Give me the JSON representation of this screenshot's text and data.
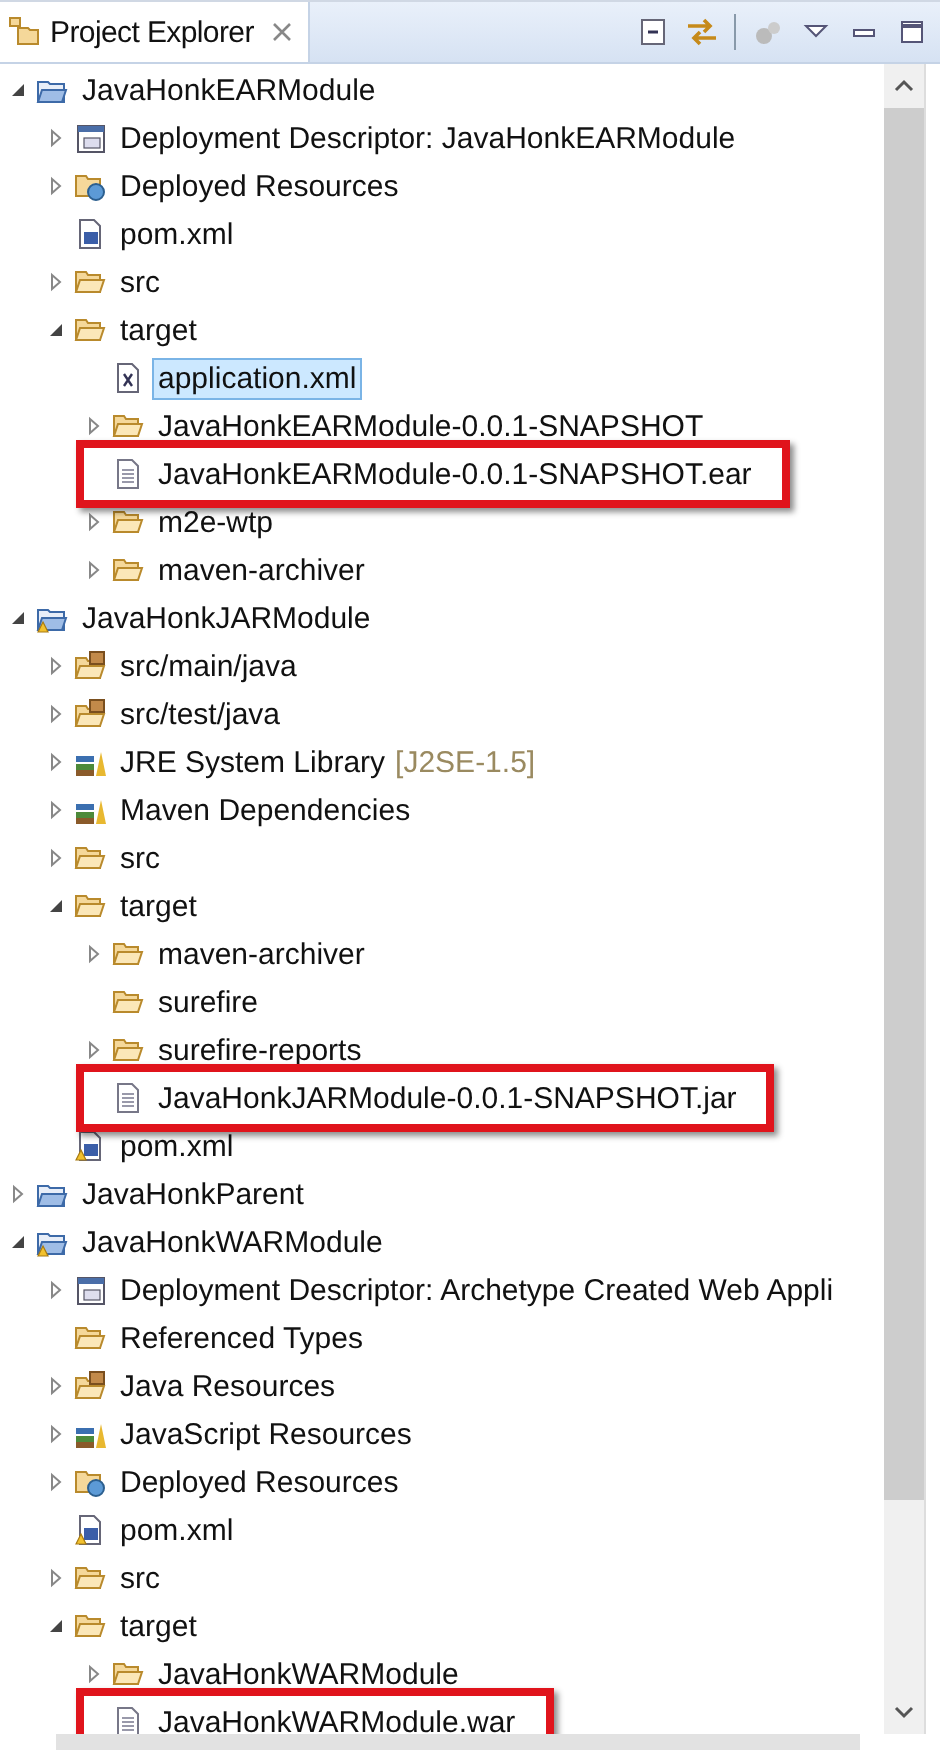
{
  "view": {
    "title": "Project Explorer"
  },
  "tree": [
    {
      "label": "JavaHonkEARModule",
      "kind": "project",
      "expanded": true,
      "selected": false,
      "highlighted": false,
      "children": [
        {
          "label": "Deployment Descriptor: JavaHonkEARModule",
          "kind": "descriptor",
          "expanded": false,
          "selected": false,
          "highlighted": false
        },
        {
          "label": "Deployed Resources",
          "kind": "deployed",
          "expanded": false,
          "selected": false,
          "highlighted": false
        },
        {
          "label": "pom.xml",
          "kind": "pom",
          "selected": false,
          "highlighted": false
        },
        {
          "label": "src",
          "kind": "folder",
          "expanded": false,
          "selected": false,
          "highlighted": false
        },
        {
          "label": "target",
          "kind": "folder",
          "expanded": true,
          "selected": false,
          "highlighted": false,
          "children": [
            {
              "label": "application.xml",
              "kind": "xml",
              "selected": true,
              "highlighted": false
            },
            {
              "label": "JavaHonkEARModule-0.0.1-SNAPSHOT",
              "kind": "folder",
              "expanded": false,
              "selected": false,
              "highlighted": false
            },
            {
              "label": "JavaHonkEARModule-0.0.1-SNAPSHOT.ear",
              "kind": "file",
              "selected": false,
              "highlighted": true
            },
            {
              "label": "m2e-wtp",
              "kind": "folder",
              "expanded": false,
              "selected": false,
              "highlighted": false
            },
            {
              "label": "maven-archiver",
              "kind": "folder",
              "expanded": false,
              "selected": false,
              "highlighted": false
            }
          ]
        }
      ]
    },
    {
      "label": "JavaHonkJARModule",
      "kind": "java-project",
      "expanded": true,
      "selected": false,
      "highlighted": false,
      "children": [
        {
          "label": "src/main/java",
          "kind": "source",
          "expanded": false,
          "selected": false,
          "highlighted": false
        },
        {
          "label": "src/test/java",
          "kind": "source",
          "expanded": false,
          "selected": false,
          "highlighted": false
        },
        {
          "label": "JRE System Library",
          "suffix": "[J2SE-1.5]",
          "kind": "library",
          "expanded": false,
          "selected": false,
          "highlighted": false
        },
        {
          "label": "Maven Dependencies",
          "kind": "library",
          "expanded": false,
          "selected": false,
          "highlighted": false
        },
        {
          "label": "src",
          "kind": "folder",
          "expanded": false,
          "selected": false,
          "highlighted": false
        },
        {
          "label": "target",
          "kind": "folder",
          "expanded": true,
          "selected": false,
          "highlighted": false,
          "children": [
            {
              "label": "maven-archiver",
              "kind": "folder",
              "expanded": false,
              "selected": false,
              "highlighted": false
            },
            {
              "label": "surefire",
              "kind": "folder",
              "selected": false,
              "highlighted": false
            },
            {
              "label": "surefire-reports",
              "kind": "folder",
              "expanded": false,
              "selected": false,
              "highlighted": false
            },
            {
              "label": "JavaHonkJARModule-0.0.1-SNAPSHOT.jar",
              "kind": "file",
              "selected": false,
              "highlighted": true
            }
          ]
        },
        {
          "label": "pom.xml",
          "kind": "pom-warning",
          "selected": false,
          "highlighted": false
        }
      ]
    },
    {
      "label": "JavaHonkParent",
      "kind": "project",
      "expanded": false,
      "selected": false,
      "highlighted": false
    },
    {
      "label": "JavaHonkWARModule",
      "kind": "java-project",
      "expanded": true,
      "selected": false,
      "highlighted": false,
      "children": [
        {
          "label": "Deployment Descriptor: Archetype Created Web Appli",
          "kind": "descriptor",
          "expanded": false,
          "selected": false,
          "highlighted": false
        },
        {
          "label": "Referenced Types",
          "kind": "folder",
          "selected": false,
          "highlighted": false
        },
        {
          "label": "Java Resources",
          "kind": "source",
          "expanded": false,
          "selected": false,
          "highlighted": false
        },
        {
          "label": "JavaScript Resources",
          "kind": "library",
          "expanded": false,
          "selected": false,
          "highlighted": false
        },
        {
          "label": "Deployed Resources",
          "kind": "deployed",
          "expanded": false,
          "selected": false,
          "highlighted": false
        },
        {
          "label": "pom.xml",
          "kind": "pom-warning",
          "selected": false,
          "highlighted": false
        },
        {
          "label": "src",
          "kind": "folder",
          "expanded": false,
          "selected": false,
          "highlighted": false
        },
        {
          "label": "target",
          "kind": "folder",
          "expanded": true,
          "selected": false,
          "highlighted": false,
          "children": [
            {
              "label": "JavaHonkWARModule",
              "kind": "folder",
              "expanded": false,
              "selected": false,
              "highlighted": false
            },
            {
              "label": "JavaHonkWARModule.war",
              "kind": "file",
              "selected": false,
              "highlighted": true
            }
          ]
        }
      ]
    }
  ]
}
